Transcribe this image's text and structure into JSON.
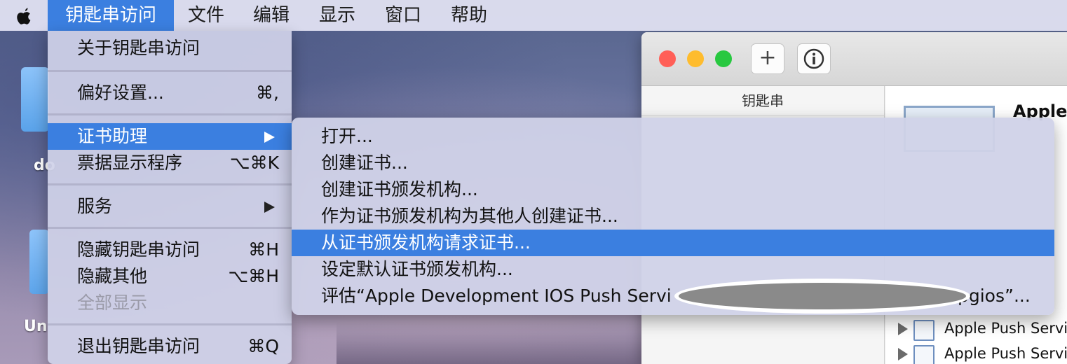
{
  "menubar": {
    "items": [
      "钥匙串访问",
      "文件",
      "编辑",
      "显示",
      "窗口",
      "帮助"
    ],
    "active_index": 0
  },
  "desktop": {
    "labels": [
      "do",
      "Un"
    ]
  },
  "app_menu": {
    "items": [
      {
        "label": "关于钥匙串访问",
        "shortcut": ""
      },
      {
        "label": "偏好设置...",
        "shortcut": "⌘,"
      },
      {
        "label": "证书助理",
        "shortcut": "",
        "submenu": true
      },
      {
        "label": "票据显示程序",
        "shortcut": "⌥⌘K"
      },
      {
        "label": "服务",
        "shortcut": "",
        "submenu": true
      },
      {
        "label": "隐藏钥匙串访问",
        "shortcut": "⌘H"
      },
      {
        "label": "隐藏其他",
        "shortcut": "⌥⌘H"
      },
      {
        "label": "全部显示",
        "shortcut": "",
        "disabled": true
      },
      {
        "label": "退出钥匙串访问",
        "shortcut": "⌘Q"
      }
    ]
  },
  "cert_submenu": {
    "items": [
      "打开...",
      "创建证书...",
      "创建证书颁发机构...",
      "作为证书颁发机构为其他人创建证书...",
      "从证书颁发机构请求证书...",
      "设定默认证书颁发机构...",
      "评估“Apple Development IOS Push Servi",
      "pgios”..."
    ],
    "highlighted_index": 4
  },
  "keychain_window": {
    "toolbar": {
      "add_icon": "+",
      "info_icon": "i"
    },
    "sidebar_header": "钥匙串",
    "content_title": "Apple",
    "rows": [
      "Apple Push Servi",
      "Apple Push Servi"
    ]
  },
  "colors": {
    "accent": "#3b7fe0",
    "close": "#ff5f57",
    "minimize": "#febc2e",
    "zoom": "#28c840"
  }
}
